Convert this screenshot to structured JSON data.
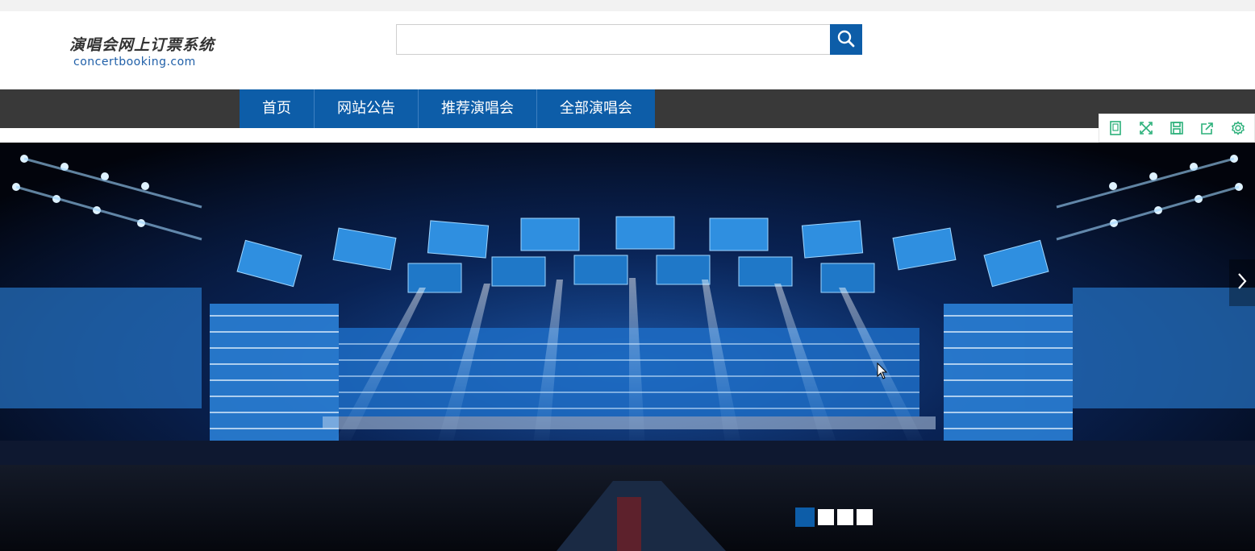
{
  "top_bar": {
    "login_hint": "",
    "login_links": ""
  },
  "header": {
    "logo_title": "演唱会网上订票系统",
    "logo_domain": "concertbooking.com",
    "search": {
      "value": "",
      "placeholder": "",
      "button_icon": "search-icon"
    }
  },
  "nav": {
    "items": [
      {
        "label": "首页"
      },
      {
        "label": "网站公告"
      },
      {
        "label": "推荐演唱会"
      },
      {
        "label": "全部演唱会"
      }
    ]
  },
  "toolbar": {
    "icons": [
      "mobile-icon",
      "fullscreen-icon",
      "save-icon",
      "share-icon",
      "settings-icon"
    ]
  },
  "banner": {
    "slide_count": 4,
    "active_slide": 1,
    "next_icon": "chevron-right-icon"
  },
  "colors": {
    "brand_blue": "#0d5da8",
    "nav_bar": "#393939",
    "top_strip": "#f2f2f2",
    "toolbar_icon": "#2bb07a",
    "login_link": "#d9302c"
  }
}
